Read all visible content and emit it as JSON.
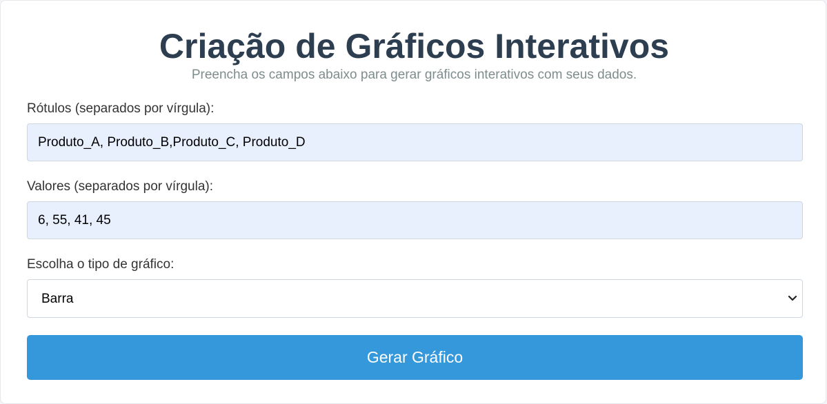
{
  "header": {
    "title": "Criação de Gráficos Interativos",
    "subtitle": "Preencha os campos abaixo para gerar gráficos interativos com seus dados."
  },
  "form": {
    "labels_field": {
      "label": "Rótulos (separados por vírgula):",
      "value": "Produto_A, Produto_B,Produto_C, Produto_D"
    },
    "values_field": {
      "label": "Valores (separados por vírgula):",
      "value": "6, 55, 41, 45"
    },
    "chart_type": {
      "label": "Escolha o tipo de gráfico:",
      "selected": "Barra",
      "icon": "chevron-down-icon"
    },
    "submit_label": "Gerar Gráfico"
  },
  "colors": {
    "title": "#2c3e50",
    "subtitle": "#7f8c8d",
    "input_bg": "#e8f0fe",
    "button_bg": "#3498db",
    "button_text": "#ffffff"
  }
}
